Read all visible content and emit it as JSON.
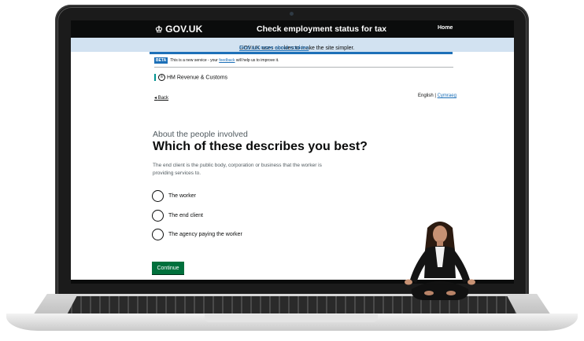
{
  "header": {
    "logo_text": "GOV.UK",
    "crown_glyph": "♔",
    "service_title": "Check employment status for tax",
    "home_link": "Home"
  },
  "cookie_banner": {
    "text": "GOV.UK uses cookies to make the site simpler.",
    "link": "Find out more about cookies"
  },
  "phase_banner": {
    "tag": "BETA",
    "text_before": "This is a new service - your",
    "link": "feedback",
    "text_after": "will help us to improve it."
  },
  "department": {
    "name": "HM Revenue & Customs",
    "crest_glyph": "♔"
  },
  "nav": {
    "back": "Back",
    "back_glyph": "◂",
    "lang_current": "English",
    "lang_separator": "|",
    "lang_other": "Cymraeg"
  },
  "question": {
    "caption": "About the people involved",
    "heading": "Which of these describes you best?",
    "hint": "The end client is the public body, corporation or business that the worker is providing services to.",
    "options": [
      "The worker",
      "The end client",
      "The agency paying the worker"
    ]
  },
  "actions": {
    "continue": "Continue"
  },
  "colors": {
    "header_bg": "#0b0c0c",
    "link_blue": "#1d70b8",
    "button_green": "#00703c",
    "cookie_bg": "#d2e2f1"
  }
}
